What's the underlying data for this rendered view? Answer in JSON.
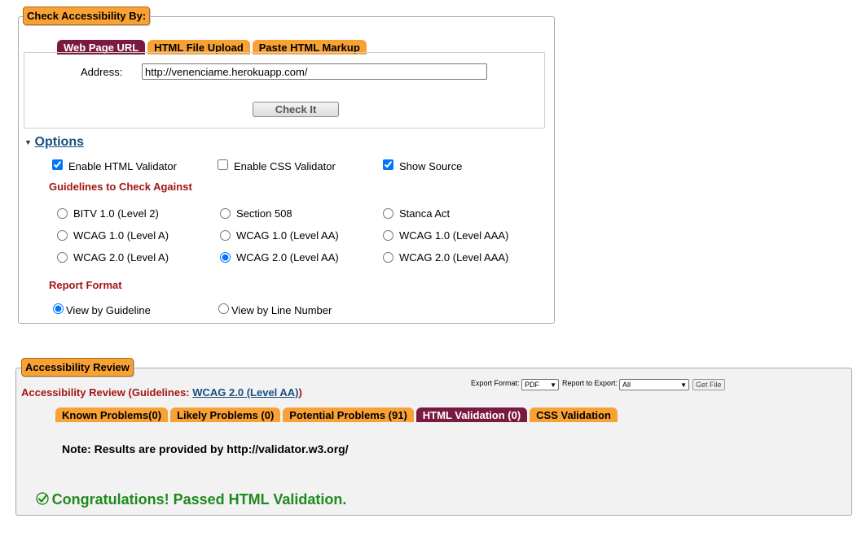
{
  "check": {
    "legend": "Check Accessibility By:",
    "tabs": [
      {
        "label": "Web Page URL"
      },
      {
        "label": "HTML File Upload"
      },
      {
        "label": "Paste HTML Markup"
      }
    ],
    "address_label": "Address:",
    "address_value": "http://venenciame.herokuapp.com/",
    "check_button": "Check It"
  },
  "options": {
    "toggle_label": "Options",
    "enable_html_validator": "Enable HTML Validator",
    "enable_css_validator": "Enable CSS Validator",
    "show_source": "Show Source",
    "guidelines_heading": "Guidelines to Check Against",
    "guidelines": [
      {
        "label": "BITV 1.0 (Level 2)"
      },
      {
        "label": "Section 508"
      },
      {
        "label": "Stanca Act"
      },
      {
        "label": "WCAG 1.0 (Level A)"
      },
      {
        "label": "WCAG 1.0 (Level AA)"
      },
      {
        "label": "WCAG 1.0 (Level AAA)"
      },
      {
        "label": "WCAG 2.0 (Level A)"
      },
      {
        "label": "WCAG 2.0 (Level AA)"
      },
      {
        "label": "WCAG 2.0 (Level AAA)"
      }
    ],
    "selected_guideline": "WCAG 2.0 (Level AA)",
    "report_heading": "Report Format",
    "view_by_guideline": "View by Guideline",
    "view_by_line": "View by Line Number"
  },
  "review": {
    "legend": "Accessibility Review",
    "title_prefix": "Accessibility Review (Guidelines: ",
    "title_link": "WCAG 2.0 (Level AA)",
    "title_suffix": ")",
    "export_format_label": "Export Format:",
    "export_format_value": "PDF",
    "report_to_export_label": "Report to Export:",
    "report_to_export_value": "All",
    "get_file_button": "Get File",
    "tabs": [
      {
        "label": "Known Problems(0)"
      },
      {
        "label": "Likely Problems (0)"
      },
      {
        "label": "Potential Problems (91)"
      },
      {
        "label": "HTML Validation (0)"
      },
      {
        "label": "CSS Validation"
      }
    ],
    "note": "Note: Results are provided by http://validator.w3.org/",
    "congrats": "Congratulations! Passed HTML Validation."
  },
  "colors": {
    "tab_orange": "#f8a236",
    "tab_active": "#7a1a40",
    "heading_red": "#a31515",
    "success_green": "#1e8a1e",
    "link_blue": "#1a4f80"
  }
}
